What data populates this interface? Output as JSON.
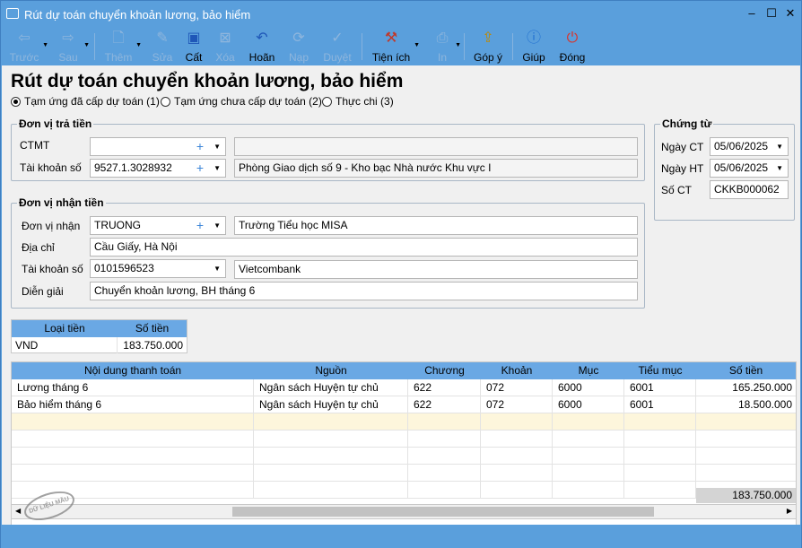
{
  "window": {
    "title": "Rút dự toán chuyển khoản lương, bảo hiểm"
  },
  "toolbar": {
    "items": [
      {
        "label": "Trước",
        "icon": "arrow-left-icon",
        "enabled": false
      },
      {
        "label": "Sau",
        "icon": "arrow-right-icon",
        "enabled": false
      },
      {
        "label": "Thêm",
        "icon": "add-document-icon",
        "enabled": false
      },
      {
        "label": "Sửa",
        "icon": "edit-icon",
        "enabled": false
      },
      {
        "label": "Cất",
        "icon": "save-icon",
        "enabled": true
      },
      {
        "label": "Xóa",
        "icon": "delete-icon",
        "enabled": false
      },
      {
        "label": "Hoãn",
        "icon": "undo-icon",
        "enabled": true
      },
      {
        "label": "Nạp",
        "icon": "refresh-icon",
        "enabled": false
      },
      {
        "label": "Duyệt",
        "icon": "check-icon",
        "enabled": false
      },
      {
        "label": "Tiện ích",
        "icon": "tools-icon",
        "enabled": true
      },
      {
        "label": "In",
        "icon": "printer-icon",
        "enabled": false
      },
      {
        "label": "Góp ý",
        "icon": "feedback-icon",
        "enabled": true
      },
      {
        "label": "Giúp",
        "icon": "help-icon",
        "enabled": true
      },
      {
        "label": "Đóng",
        "icon": "power-icon",
        "enabled": true
      }
    ]
  },
  "page_title": "Rút dự toán chuyển khoản lương, bảo hiểm",
  "options": [
    {
      "label": "Tạm ứng đã cấp dự toán (1)",
      "selected": true
    },
    {
      "label": "Tạm ứng chưa cấp dự toán (2)",
      "selected": false
    },
    {
      "label": "Thực chi (3)",
      "selected": false
    }
  ],
  "payer": {
    "legend": "Đơn vị trả tiền",
    "ctmt_label": "CTMT",
    "ctmt_value": "",
    "ctmt_name": "",
    "account_label": "Tài khoản số",
    "account_value": "9527.1.3028932",
    "account_name": "Phòng Giao dịch số 9 - Kho bạc Nhà nước Khu vực I"
  },
  "receiver": {
    "legend": "Đơn vị nhận tiền",
    "unit_label": "Đơn vị nhận",
    "unit_code": "TRUONG",
    "unit_name": "Trường Tiểu học MISA",
    "address_label": "Địa chỉ",
    "address_value": "Cầu Giấy, Hà Nội",
    "account_label": "Tài khoản số",
    "account_value": "0101596523",
    "bank_name": "Vietcombank",
    "desc_label": "Diễn giải",
    "desc_value": "Chuyển khoản lương, BH  tháng 6"
  },
  "voucher": {
    "legend": "Chứng từ",
    "date_ct_label": "Ngày CT",
    "date_ct": "05/06/2025",
    "date_ht_label": "Ngày HT",
    "date_ht": "05/06/2025",
    "no_label": "Số CT",
    "no_value": "CKKB000062"
  },
  "currency_grid": {
    "headers": [
      "Loại tiền",
      "Số tiền"
    ],
    "row": [
      "VND",
      "183.750.000"
    ]
  },
  "detail_grid": {
    "headers": [
      "Nội dung thanh toán",
      "Nguồn",
      "Chương",
      "Khoản",
      "Mục",
      "Tiểu mục",
      "Số tiền"
    ],
    "rows": [
      [
        "Lương tháng 6",
        "Ngân sách Huyện tự chủ",
        "622",
        "072",
        "6000",
        "6001",
        "165.250.000"
      ],
      [
        "Bảo hiểm tháng 6",
        "Ngân sách Huyện tự chủ",
        "622",
        "072",
        "6000",
        "6001",
        "18.500.000"
      ]
    ],
    "total": "183.750.000"
  },
  "stamp_text": "DỮ LIỆU MẪU"
}
